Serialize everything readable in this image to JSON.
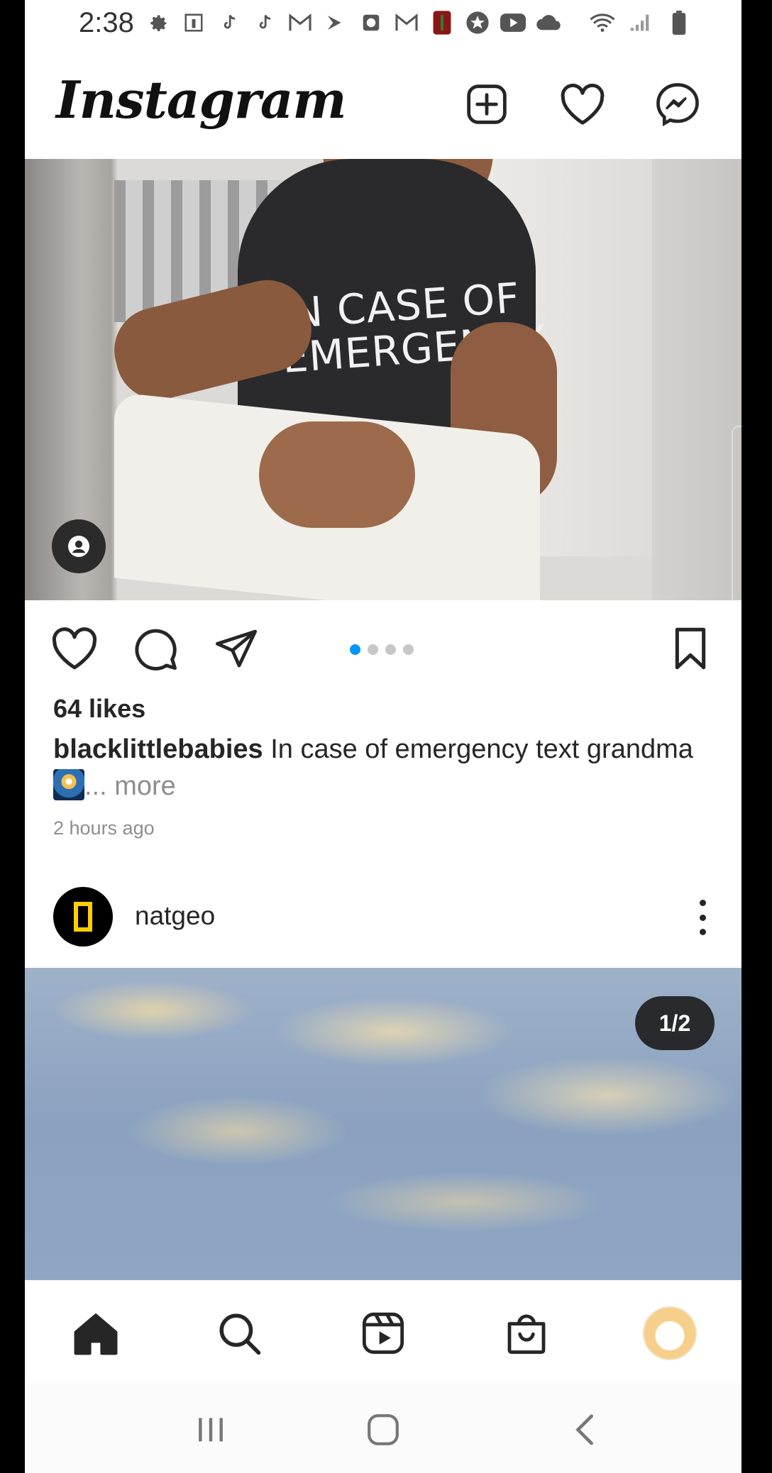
{
  "status_bar": {
    "time": "2:38"
  },
  "header": {
    "logo": "Instagram"
  },
  "post1": {
    "shirt_text": [
      "IN CASE OF",
      "EMERGENCY"
    ],
    "carousel": {
      "count": 4,
      "active_index": 0
    },
    "likes": "64 likes",
    "username": "blacklittlebabies",
    "caption": "In case of emergency text grandma",
    "more": "... more",
    "time_ago": "2 hours ago"
  },
  "post2": {
    "username": "natgeo",
    "counter": "1/2"
  },
  "colors": {
    "accent": "#0095f6",
    "text": "#262626",
    "muted": "#8e8e8e",
    "natgeo_yellow": "#ffcf00"
  }
}
